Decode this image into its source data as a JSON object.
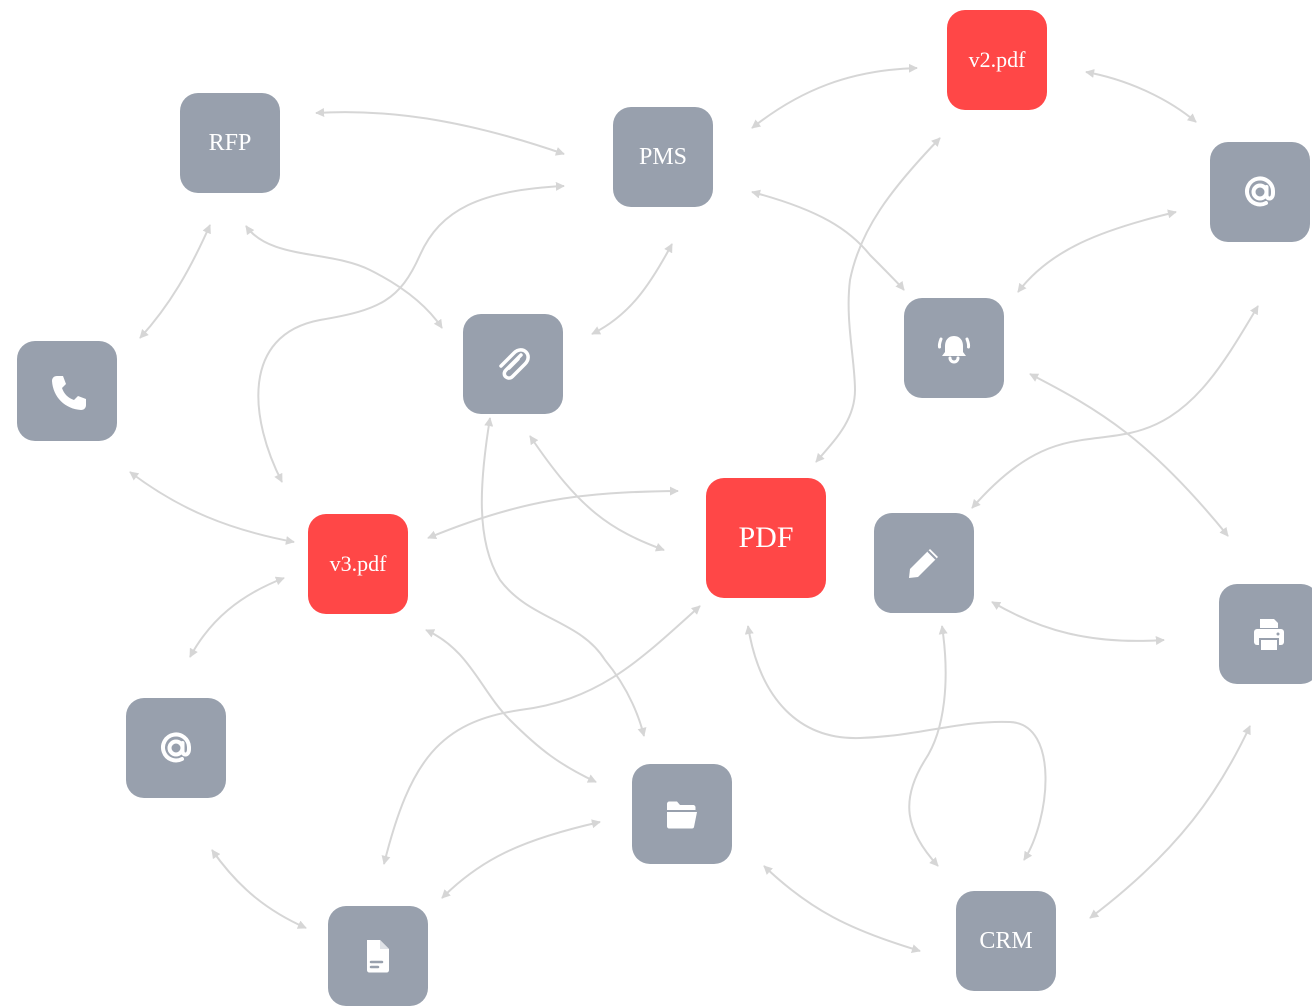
{
  "colors": {
    "node": "#98a0ad",
    "accent": "#ff4747",
    "edge": "#d6d6d6",
    "label": "#ffffff"
  },
  "nodes": {
    "rfp": {
      "label": "RFP"
    },
    "pms": {
      "label": "PMS"
    },
    "v2pdf": {
      "label": "v2.pdf"
    },
    "at_top_right": {
      "icon": "at-sign-icon"
    },
    "phone": {
      "icon": "phone-icon"
    },
    "attachment": {
      "icon": "paperclip-icon"
    },
    "bell": {
      "icon": "bell-icon"
    },
    "v3pdf": {
      "label": "v3.pdf"
    },
    "pdf": {
      "label": "PDF"
    },
    "pencil": {
      "icon": "pencil-icon"
    },
    "printer": {
      "icon": "printer-icon"
    },
    "at_left": {
      "icon": "at-sign-icon"
    },
    "folder": {
      "icon": "folder-icon"
    },
    "document": {
      "icon": "document-icon"
    },
    "crm": {
      "label": "CRM"
    }
  },
  "connections": [
    [
      "rfp",
      "pms"
    ],
    [
      "rfp",
      "phone"
    ],
    [
      "rfp",
      "attachment"
    ],
    [
      "pms",
      "v2pdf"
    ],
    [
      "pms",
      "v3pdf"
    ],
    [
      "pms",
      "attachment"
    ],
    [
      "pms",
      "bell"
    ],
    [
      "v2pdf",
      "at_top_right"
    ],
    [
      "v2pdf",
      "pdf"
    ],
    [
      "at_top_right",
      "bell"
    ],
    [
      "at_top_right",
      "pencil"
    ],
    [
      "phone",
      "v3pdf"
    ],
    [
      "v3pdf",
      "pdf"
    ],
    [
      "v3pdf",
      "at_left"
    ],
    [
      "v3pdf",
      "folder"
    ],
    [
      "attachment",
      "pdf"
    ],
    [
      "attachment",
      "folder"
    ],
    [
      "bell",
      "printer"
    ],
    [
      "pencil",
      "printer"
    ],
    [
      "pencil",
      "crm"
    ],
    [
      "pdf",
      "document"
    ],
    [
      "pdf",
      "crm"
    ],
    [
      "printer",
      "crm"
    ],
    [
      "at_left",
      "document"
    ],
    [
      "document",
      "folder"
    ],
    [
      "folder",
      "crm"
    ]
  ]
}
